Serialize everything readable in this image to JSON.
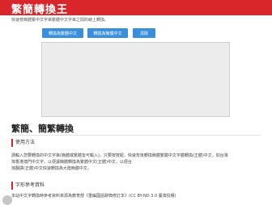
{
  "header": {
    "title": "繁簡轉換王"
  },
  "intro": {
    "text": "快速普簡體繁中文字串繁體中文字串之間的線上轉換。"
  },
  "buttons": {
    "to_traditional": "轉換為繁體中文",
    "to_simplified": "轉換為簡體中文",
    "clear": "清除"
  },
  "editor": {
    "value": ""
  },
  "section": {
    "heading": "繁簡、簡繁轉換",
    "usage_heading": "使用方法",
    "usage_lines": [
      "請輸入您要轉換的中文字串(簡體或繁體皆可輸入)，只要按按鈕，快速背後轉換簡體繁體中文字體轉換(正體)中文，如台灣",
      "灣香港澳門中文字，以便讓簡體轉換為繁體中文(正體)中文，以便台",
      "灣翻譯(正體)中文快速轉換為大陸簡體中文。"
    ],
    "reference_heading": "字形參考資料",
    "reference_line": "本站中文字轉換時參考資料來源為教育部《重編國語辭典修訂本》(CC BY-ND 3.0 臺灣授權)"
  }
}
